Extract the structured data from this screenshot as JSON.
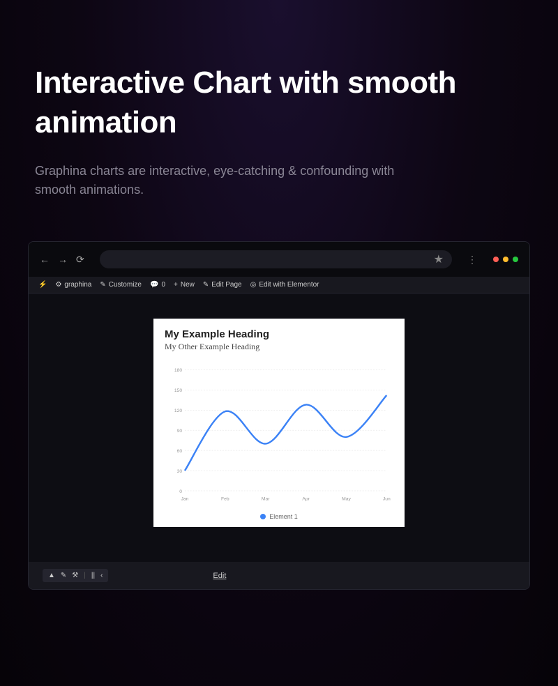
{
  "hero": {
    "title": "Interactive Chart with smooth animation",
    "subtitle": "Graphina charts are interactive, eye-catching & confounding with smooth animations."
  },
  "browser": {
    "nav": {
      "back": "←",
      "forward": "→",
      "reload": "⟳"
    },
    "star": "★",
    "menu": "⋮"
  },
  "wpbar": {
    "logo": "⚡",
    "site_icon": "⚙",
    "site": "graphina",
    "customize_icon": "✎",
    "customize": "Customize",
    "comment_icon": "💬",
    "comments": "0",
    "new_icon": "+",
    "new": "New",
    "edit_icon": "✎",
    "edit": "Edit Page",
    "elementor_icon": "◎",
    "elementor": "Edit with Elementor"
  },
  "chart": {
    "title": "My Example Heading",
    "subtitle": "My Other Example Heading",
    "legend": "Element 1"
  },
  "chart_data": {
    "type": "line",
    "categories": [
      "Jan",
      "Feb",
      "Mar",
      "Apr",
      "May",
      "Jun"
    ],
    "values": [
      30,
      118,
      70,
      128,
      80,
      142
    ],
    "title": "My Example Heading",
    "xlabel": "",
    "ylabel": "",
    "ylim": [
      0,
      180
    ],
    "yticks": [
      0,
      30,
      60,
      90,
      120,
      150,
      180
    ],
    "legend": "Element 1"
  },
  "toolbar": {
    "pointer": "▲",
    "pencil": "✎",
    "bush": "⚒",
    "pause": "||",
    "back": "‹",
    "edit": "Edit"
  }
}
